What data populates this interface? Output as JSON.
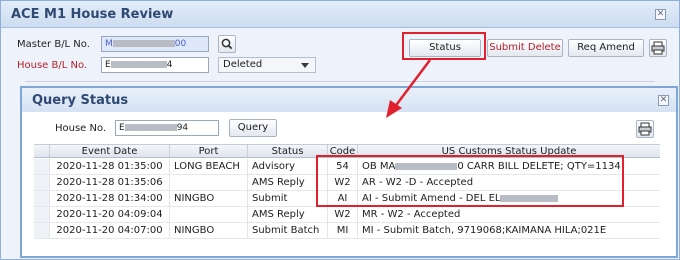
{
  "outer": {
    "title": "ACE M1 House Review",
    "close": "✕",
    "master_label": "Master B/L No.",
    "master_value_start": "M",
    "master_value_end": "00",
    "house_label": "House B/L No.",
    "house_value_start": "E",
    "house_value_end": "4",
    "status_select": "Deleted",
    "buttons": {
      "status": "Status",
      "submit_delete": "Submit Delete",
      "req_amend": "Req Amend"
    }
  },
  "query": {
    "title": "Query Status",
    "close": "✕",
    "house_label": "House No.",
    "house_value_start": "E",
    "house_value_end": "94",
    "query_button": "Query",
    "columns": [
      "Event Date",
      "Port",
      "Status",
      "Code",
      "US Customs Status Update"
    ],
    "rows": [
      {
        "date": "2020-11-28 01:35:00",
        "port": "LONG BEACH",
        "status": "Advisory",
        "code": "54",
        "update_a": "OB MA",
        "update_b": "0 CARR BILL DELETE; QTY=1134"
      },
      {
        "date": "2020-11-28 01:35:06",
        "port": "",
        "status": "AMS Reply",
        "code": "W2",
        "update_a": "AR - W2 -D - Accepted",
        "update_b": ""
      },
      {
        "date": "2020-11-28 01:34:00",
        "port": "NINGBO",
        "status": "Submit",
        "code": "AI",
        "update_a": "AI - Submit Amend - DEL EL",
        "update_b": ""
      },
      {
        "date": "2020-11-20 04:09:04",
        "port": "",
        "status": "AMS Reply",
        "code": "W2",
        "update_a": "MR - W2 - Accepted",
        "update_b": ""
      },
      {
        "date": "2020-11-20 04:07:00",
        "port": "NINGBO",
        "status": "Submit Batch",
        "code": "MI",
        "update_a": "MI - Submit Batch, 9719068;KAIMANA HILA;021E",
        "update_b": ""
      }
    ]
  },
  "colors": {
    "annotation": "#e0202c",
    "title_text": "#2f4a72",
    "red_label": "#b3202a"
  },
  "icons": [
    "search-icon",
    "printer-icon",
    "close-icon",
    "dropdown-arrow-icon",
    "annotation-arrow"
  ]
}
